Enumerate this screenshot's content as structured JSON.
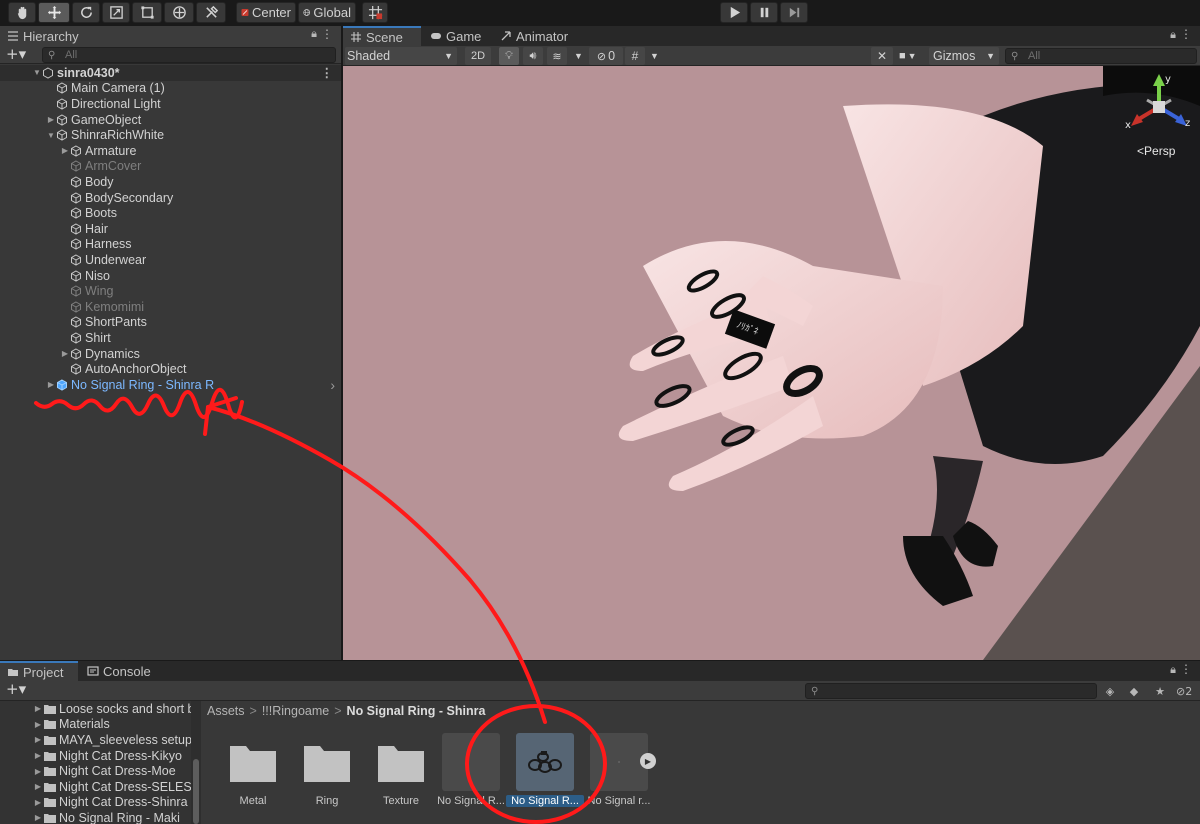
{
  "toolbar": {
    "pivot_label": "Center",
    "space_label": "Global"
  },
  "hierarchy": {
    "tab_label": "Hierarchy",
    "search_placeholder": "All",
    "scene_name": "sinra0430*",
    "items": [
      {
        "label": "Main Camera (1)"
      },
      {
        "label": "Directional Light"
      },
      {
        "label": "GameObject"
      },
      {
        "label": "ShinraRichWhite"
      },
      {
        "label": "Armature"
      },
      {
        "label": "ArmCover"
      },
      {
        "label": "Body"
      },
      {
        "label": "BodySecondary"
      },
      {
        "label": "Boots"
      },
      {
        "label": "Hair"
      },
      {
        "label": "Harness"
      },
      {
        "label": "Underwear"
      },
      {
        "label": "Niso"
      },
      {
        "label": "Wing"
      },
      {
        "label": "Kemomimi"
      },
      {
        "label": "ShortPants"
      },
      {
        "label": "Shirt"
      },
      {
        "label": "Dynamics"
      },
      {
        "label": "AutoAnchorObject"
      },
      {
        "label": "No Signal Ring - Shinra R"
      }
    ]
  },
  "scene": {
    "tabs": [
      {
        "label": "Scene"
      },
      {
        "label": "Game"
      },
      {
        "label": "Animator"
      }
    ],
    "shading_mode": "Shaded",
    "mode_2d": "2D",
    "hidden_count": "0",
    "gizmos_label": "Gizmos",
    "search_placeholder": "All",
    "gizmo": {
      "x_label": "x",
      "y_label": "y",
      "z_label": "z",
      "projection": "Persp"
    },
    "ring_text": "ﾉﾘｶﾞﾈ"
  },
  "project": {
    "tabs": [
      {
        "label": "Project"
      },
      {
        "label": "Console"
      }
    ],
    "tree": [
      {
        "label": "Loose socks and short b"
      },
      {
        "label": "Materials"
      },
      {
        "label": "MAYA_sleeveless setup"
      },
      {
        "label": "Night Cat Dress-Kikyo"
      },
      {
        "label": "Night Cat Dress-Moe"
      },
      {
        "label": "Night Cat Dress-SELES"
      },
      {
        "label": "Night Cat Dress-Shinra"
      },
      {
        "label": "No Signal Ring - Maki"
      }
    ],
    "breadcrumb": [
      "Assets",
      "!!!Ringoame",
      "No Signal Ring - Shinra"
    ],
    "assets": [
      {
        "label": "Metal"
      },
      {
        "label": "Ring"
      },
      {
        "label": "Texture"
      },
      {
        "label": "No Signal R..."
      },
      {
        "label": "No Signal R..."
      },
      {
        "label": "No Signal r..."
      }
    ],
    "hidden_count_fragment": "2"
  },
  "colors": {
    "accent": "#3a79bb",
    "viewport_bg": "#b79397",
    "annotation": "#ff1a1a",
    "prefab_text": "#7cb8ff"
  }
}
